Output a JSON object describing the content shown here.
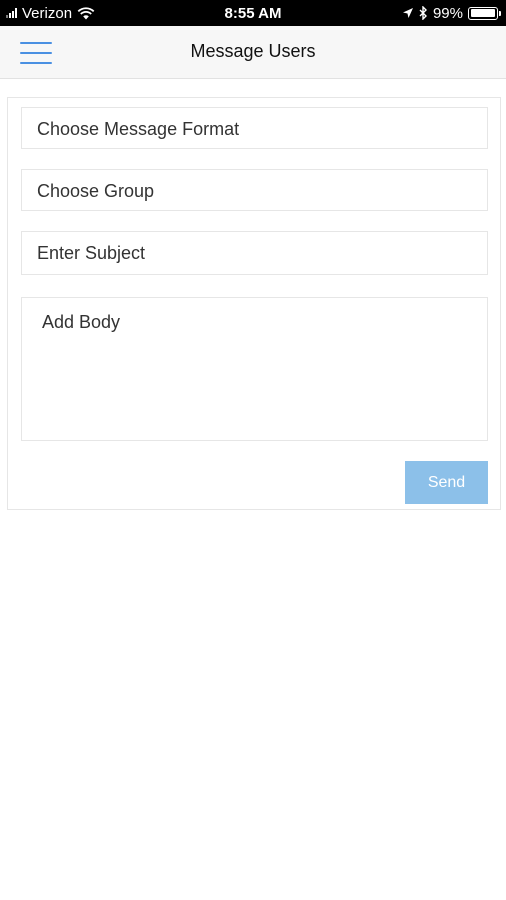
{
  "status_bar": {
    "carrier": "Verizon",
    "time": "8:55 AM",
    "battery": "99%",
    "battery_level": 0.99,
    "icons": [
      "signal-icon",
      "wifi-icon",
      "location-arrow-icon",
      "bluetooth-icon",
      "battery-icon"
    ]
  },
  "header": {
    "title": "Message Users",
    "menu_icon": "hamburger-menu-icon",
    "menu_color": "#4a90e2"
  },
  "form": {
    "message_format": {
      "value": "Choose Message Format"
    },
    "group": {
      "value": "Choose Group"
    },
    "subject": {
      "placeholder": "Enter Subject"
    },
    "body": {
      "placeholder": "Add Body"
    },
    "send_label": "Send",
    "send_color": "#8cc0e9"
  }
}
